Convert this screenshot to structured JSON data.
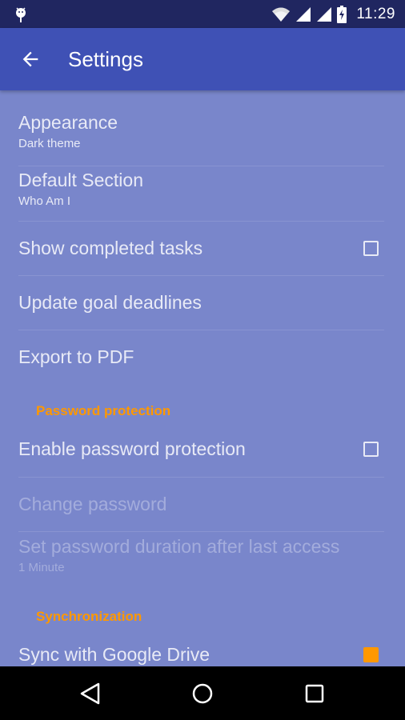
{
  "status_bar": {
    "time": "11:29",
    "icons": [
      "android-debug-icon",
      "wifi-icon",
      "cell-signal-icon",
      "cell-signal-icon",
      "battery-charging-icon"
    ]
  },
  "app_bar": {
    "title": "Settings",
    "back_icon": "arrow-back-icon"
  },
  "preferences": [
    {
      "title": "Appearance",
      "summary": "Dark theme",
      "enabled": true
    },
    {
      "title": "Default Section",
      "summary": "Who Am I",
      "enabled": true
    },
    {
      "title": "Show completed tasks",
      "checkbox": true,
      "checked": false,
      "enabled": true
    },
    {
      "title": "Update goal deadlines",
      "enabled": true
    },
    {
      "title": "Export to PDF",
      "enabled": true
    }
  ],
  "password_category": {
    "title": "Password protection",
    "items": [
      {
        "title": "Enable password protection",
        "checkbox": true,
        "checked": false,
        "enabled": true
      },
      {
        "title": "Change password",
        "enabled": false
      },
      {
        "title": "Set password duration after last access",
        "summary": "1 Minute",
        "enabled": false
      }
    ]
  },
  "sync_category": {
    "title": "Synchronization",
    "items": [
      {
        "title": "Sync with Google Drive",
        "checkbox": true,
        "checked": true,
        "enabled": true
      }
    ]
  },
  "nav_bar": {
    "buttons": [
      "back-icon",
      "home-icon",
      "recents-icon"
    ]
  },
  "colors": {
    "status_bar": "#202660",
    "primary": "#3F51B5",
    "background": "#7986CB",
    "accent": "#FF9800",
    "text": "#E8EAF6"
  }
}
